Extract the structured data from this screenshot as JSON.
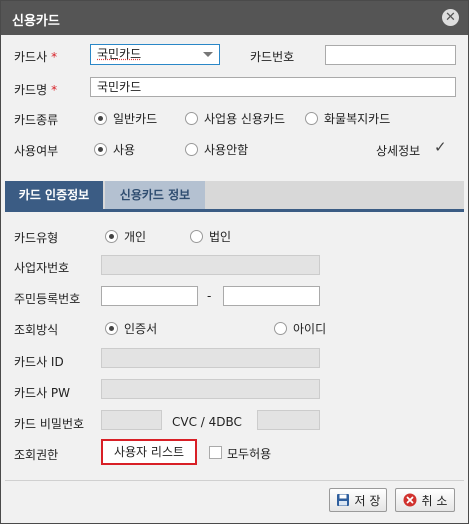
{
  "dialog": {
    "title": "신용카드"
  },
  "form": {
    "card_company": {
      "label": "카드사",
      "required_mark": "*",
      "value": "국민카드"
    },
    "card_number": {
      "label": "카드번호",
      "value": ""
    },
    "card_name": {
      "label": "카드명",
      "required_mark": "*",
      "value": "국민카드"
    },
    "card_kind": {
      "label": "카드종류",
      "options": [
        "일반카드",
        "사업용 신용카드",
        "화물복지카드"
      ],
      "selected": "일반카드"
    },
    "use_yn": {
      "label": "사용여부",
      "options": [
        "사용",
        "사용안함"
      ],
      "selected": "사용"
    },
    "detail_info": {
      "label": "상세정보",
      "checked": true
    }
  },
  "tabs": [
    {
      "label": "카드 인증정보",
      "active": true
    },
    {
      "label": "신용카드 정보",
      "active": false
    }
  ],
  "auth": {
    "card_type": {
      "label": "카드유형",
      "options": [
        "개인",
        "법인"
      ],
      "selected": "개인"
    },
    "business_no": {
      "label": "사업자번호",
      "value": ""
    },
    "resident_no": {
      "label": "주민등록번호",
      "separator": "-",
      "first": "",
      "second": ""
    },
    "query_method": {
      "label": "조회방식",
      "options": [
        "인증서",
        "아이디"
      ],
      "selected": "인증서"
    },
    "card_id": {
      "label": "카드사 ID",
      "value": ""
    },
    "card_pw": {
      "label": "카드사 PW",
      "value": ""
    },
    "card_pin": {
      "label": "카드 비밀번호",
      "value": ""
    },
    "cvc": {
      "label": "CVC / 4DBC",
      "value": ""
    },
    "permission": {
      "label": "조회권한",
      "button": "사용자 리스트",
      "allow_all_label": "모두허용",
      "allow_all_checked": false
    }
  },
  "footer": {
    "save": "저 장",
    "cancel": "취 소"
  },
  "colors": {
    "titlebar": "#555555",
    "tab_active": "#3b5c84",
    "tab_inactive": "#b4c1d1",
    "required": "#d81f26",
    "select_border": "#2a87c7"
  }
}
